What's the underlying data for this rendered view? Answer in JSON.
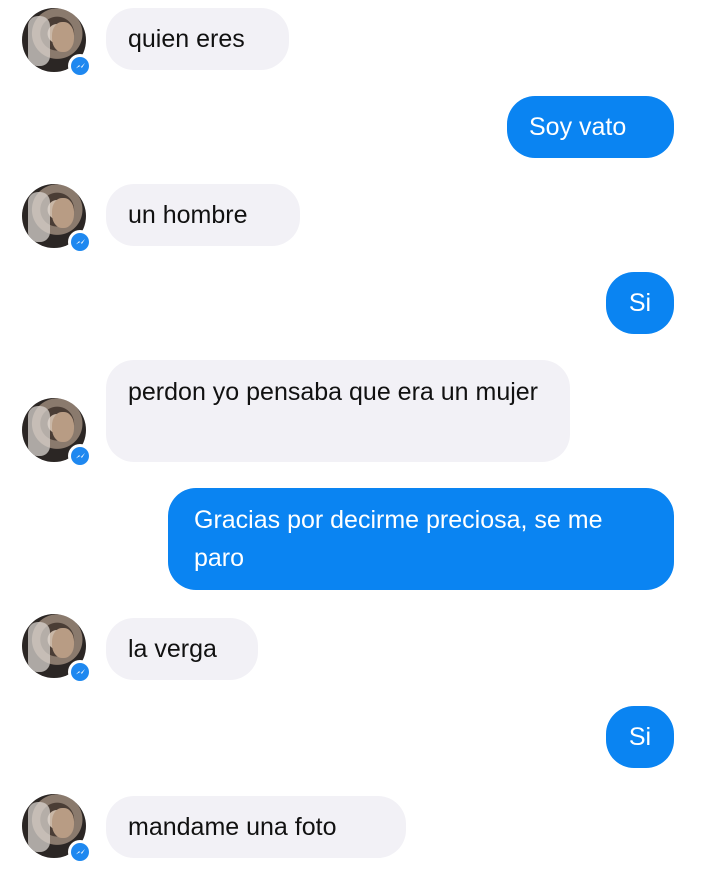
{
  "messages": [
    {
      "sender": "other",
      "text": "quien eres"
    },
    {
      "sender": "me",
      "text": "Soy vato"
    },
    {
      "sender": "other",
      "text": "un hombre"
    },
    {
      "sender": "me",
      "text": "Si"
    },
    {
      "sender": "other",
      "text": "perdon yo pensaba que era un mujer"
    },
    {
      "sender": "me",
      "text": "Gracias por decirme preciosa, se me paro"
    },
    {
      "sender": "other",
      "text": "la verga"
    },
    {
      "sender": "me",
      "text": "Si"
    },
    {
      "sender": "other",
      "text": "mandame una foto"
    }
  ],
  "colors": {
    "incoming_bubble": "#f2f1f6",
    "outgoing_bubble": "#0a84f2",
    "messenger_badge": "#1e88f0"
  },
  "icons": {
    "avatar_badge": "messenger-icon"
  }
}
